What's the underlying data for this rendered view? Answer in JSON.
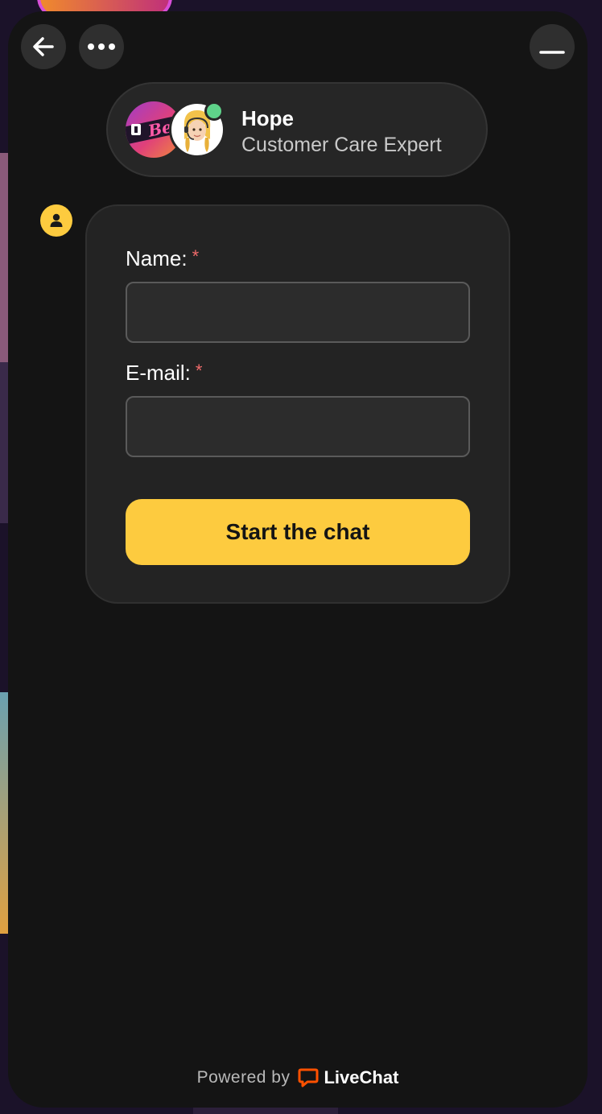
{
  "icons": {
    "back": "arrow-left-icon",
    "more": "more-horizontal-icon",
    "minimize": "minimize-icon",
    "system": "user-icon",
    "livechat": "livechat-logo-icon"
  },
  "colors": {
    "accent": "#fdcb3f",
    "widget_bg": "#141414",
    "card_bg": "#232323",
    "online": "#5fd38a",
    "required": "#f06b6b",
    "livechat_orange": "#ff5100"
  },
  "header": {
    "agent": {
      "name": "Hope",
      "role": "Customer Care Expert",
      "status": "online",
      "brand_logo_text": "Bet"
    }
  },
  "form": {
    "name_label": "Name:",
    "email_label": "E-mail:",
    "required_mark": "*",
    "name_value": "",
    "email_value": "",
    "submit_label": "Start the chat"
  },
  "footer": {
    "powered_by": "Powered by",
    "brand": "LiveChat"
  }
}
